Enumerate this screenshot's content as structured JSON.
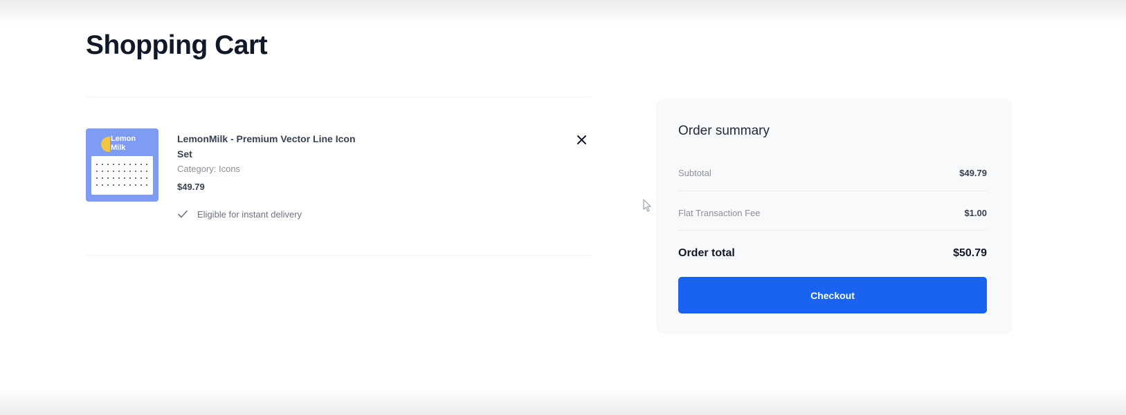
{
  "page": {
    "title": "Shopping Cart"
  },
  "cart": {
    "items": [
      {
        "thumbnail_text": "Lemon Milk",
        "name": "LemonMilk - Premium Vector Line Icon Set",
        "category": "Category: Icons",
        "price": "$49.79",
        "delivery": "Eligible for instant delivery",
        "delivery_icon": "check-icon",
        "remove_icon": "close-icon"
      }
    ]
  },
  "summary": {
    "title": "Order summary",
    "subtotal_label": "Subtotal",
    "subtotal_value": "$49.79",
    "fee_label": "Flat Transaction Fee",
    "fee_value": "$1.00",
    "total_label": "Order total",
    "total_value": "$50.79",
    "checkout_label": "Checkout"
  },
  "colors": {
    "accent": "#1a63f0",
    "thumbnail_bg": "#7f9cf5",
    "summary_bg": "#f8f9fb",
    "check": "#6b7280"
  }
}
